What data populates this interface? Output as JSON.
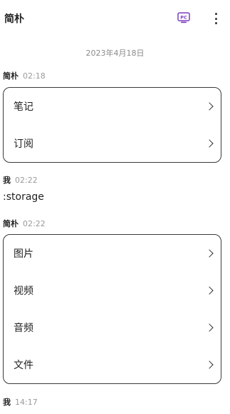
{
  "header": {
    "title": "简朴",
    "pc_icon": "pc-icon",
    "more_icon": "more-vertical-icon",
    "accent_color": "#7b3fbf"
  },
  "date_separator": "2023年4月18日",
  "messages": [
    {
      "sender": "简朴",
      "time": "02:18",
      "type": "card",
      "items": [
        {
          "label": "笔记"
        },
        {
          "label": "订阅"
        }
      ]
    },
    {
      "sender": "我",
      "time": "02:22",
      "type": "text",
      "text": ":storage"
    },
    {
      "sender": "简朴",
      "time": "02:22",
      "type": "card",
      "items": [
        {
          "label": "图片"
        },
        {
          "label": "视频"
        },
        {
          "label": "音频"
        },
        {
          "label": "文件"
        }
      ]
    },
    {
      "sender": "我",
      "time": "14:17",
      "type": "text",
      "text": ""
    }
  ]
}
